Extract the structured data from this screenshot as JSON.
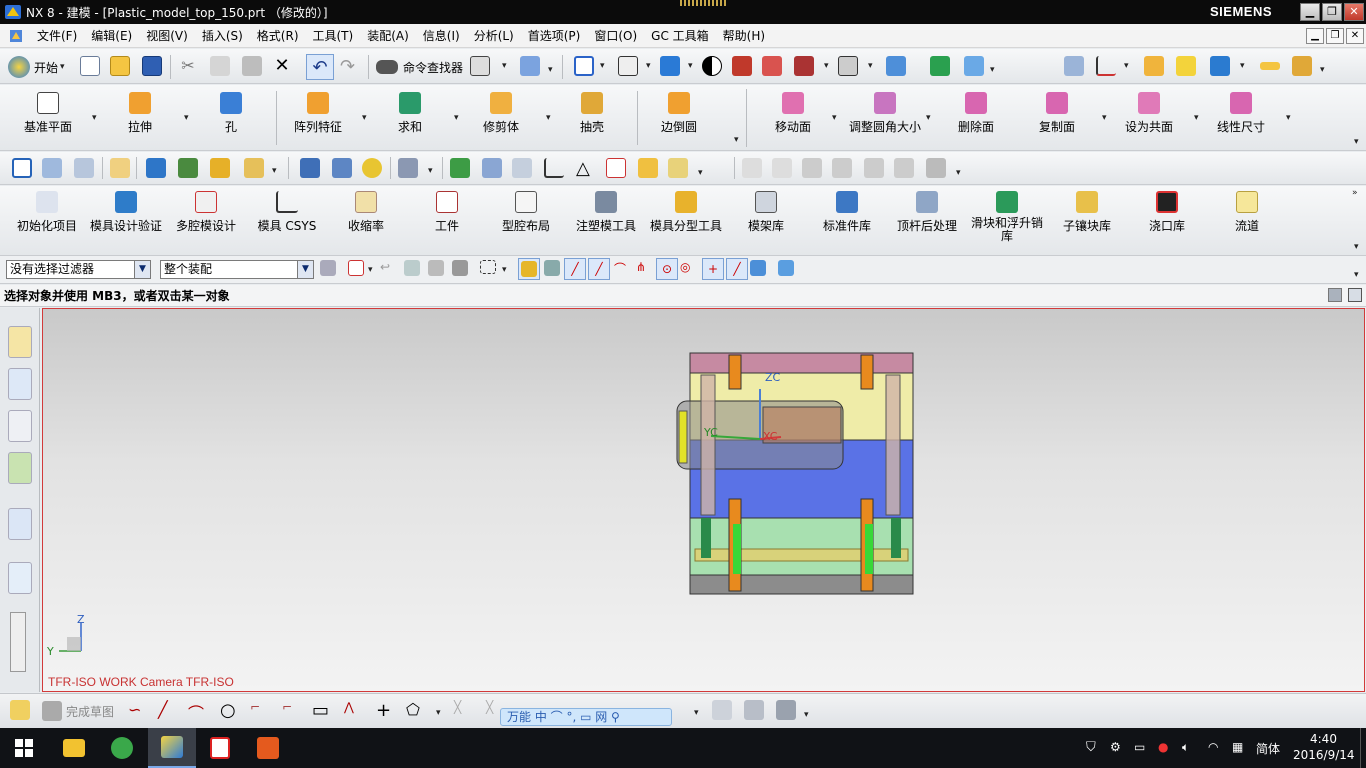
{
  "titlebar": {
    "title": "NX 8 - 建模 - [Plastic_model_top_150.prt （修改的）]",
    "brand": "SIEMENS",
    "buttons": [
      "minimize",
      "restore",
      "close"
    ]
  },
  "menubar": {
    "items": [
      "文件(F)",
      "编辑(E)",
      "视图(V)",
      "插入(S)",
      "格式(R)",
      "工具(T)",
      "装配(A)",
      "信息(I)",
      "分析(L)",
      "首选项(P)",
      "窗口(O)",
      "GC 工具箱",
      "帮助(H)"
    ]
  },
  "standard_toolbar": {
    "start_label": "开始",
    "command_finder_label": "命令查找器"
  },
  "feature_toolbar": {
    "items": [
      "基准平面",
      "拉伸",
      "孔",
      "阵列特征",
      "求和",
      "修剪体",
      "抽壳",
      "边倒圆",
      "移动面",
      "调整圆角大小",
      "删除面",
      "复制面",
      "设为共面",
      "线性尺寸"
    ]
  },
  "mold_toolbar": {
    "items": [
      "初始化项目",
      "模具设计验证",
      "多腔模设计",
      "模具 CSYS",
      "收缩率",
      "工件",
      "型腔布局",
      "注塑模工具",
      "模具分型工具",
      "模架库",
      "标准件库",
      "顶杆后处理",
      "滑块和浮升销库",
      "子镶块库",
      "浇口库",
      "流道"
    ]
  },
  "selection_bar": {
    "filter_value": "没有选择过滤器",
    "scope_value": "整个装配"
  },
  "status": {
    "prompt": "选择对象并使用 MB3，或者双击某一对象"
  },
  "viewport": {
    "label": "TFR-ISO WORK Camera TFR-ISO",
    "axes": {
      "zc": "ZC",
      "yc": "YC",
      "xc": "XC",
      "z": "Z",
      "y": "Y"
    }
  },
  "bottom_toolbar": {
    "finish_sketch_label": "完成草图",
    "ime_label": "万能 中 ⌒ °, ▭ 网 ⚲"
  },
  "taskbar": {
    "ime_lang": "简体",
    "time": "4:40",
    "date": "2016/9/14"
  }
}
